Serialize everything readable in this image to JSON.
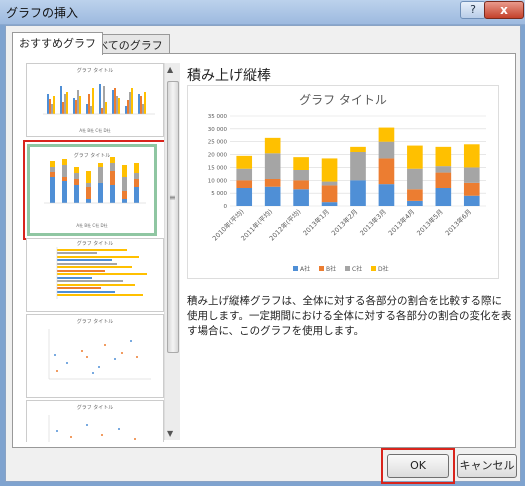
{
  "window": {
    "title": "グラフの挿入",
    "help_icon": "?",
    "close_icon": "x"
  },
  "tabs": [
    {
      "label": "おすすめグラフ"
    },
    {
      "label": "すべてのグラフ"
    }
  ],
  "thumbs": [
    {
      "title": "グラフ タイトル",
      "legend": "A社 B社 C社 D社"
    },
    {
      "title": "グラフ タイトル",
      "legend": "A社 B社 C社 D社"
    },
    {
      "title": "グラフ タイトル"
    },
    {
      "title": "グラフ タイトル"
    },
    {
      "title": "グラフ タイトル"
    }
  ],
  "heading": "積み上げ縦棒",
  "description": "積み上げ縦棒グラフは、全体に対する各部分の割合を比較する際に使用します。一定期間における全体に対する各部分の割合の変化を表す場合に、このグラフを使用します。",
  "buttons": {
    "ok": "OK",
    "cancel": "キャンセル"
  },
  "chart_data": {
    "type": "bar",
    "stacked": true,
    "title": "グラフ タイトル",
    "categories": [
      "2010年(平均)",
      "2011年(平均)",
      "2012年(平均)",
      "2013年1月",
      "2013年2月",
      "2013年3月",
      "2013年4月",
      "2013年5月",
      "2013年6月"
    ],
    "series": [
      {
        "name": "A社",
        "color": "#4f8fd6",
        "values": [
          7000,
          7500,
          6500,
          1500,
          10000,
          8500,
          2000,
          7000,
          4000
        ]
      },
      {
        "name": "B社",
        "color": "#ec7d31",
        "values": [
          3000,
          3000,
          3500,
          6500,
          0,
          10000,
          4500,
          6000,
          5000
        ]
      },
      {
        "name": "C社",
        "color": "#a5a5a5",
        "values": [
          4500,
          10000,
          4000,
          1500,
          11000,
          6500,
          8000,
          2500,
          6000
        ]
      },
      {
        "name": "D社",
        "color": "#ffc000",
        "values": [
          5000,
          6000,
          5000,
          9000,
          2000,
          5500,
          9000,
          7500,
          9000
        ]
      }
    ],
    "ylim": [
      0,
      35000
    ],
    "yticks": [
      "0",
      "5 000",
      "10 000",
      "15 000",
      "20 000",
      "25 000",
      "30 000",
      "35 000"
    ],
    "grid": true,
    "legend": "bottom"
  }
}
